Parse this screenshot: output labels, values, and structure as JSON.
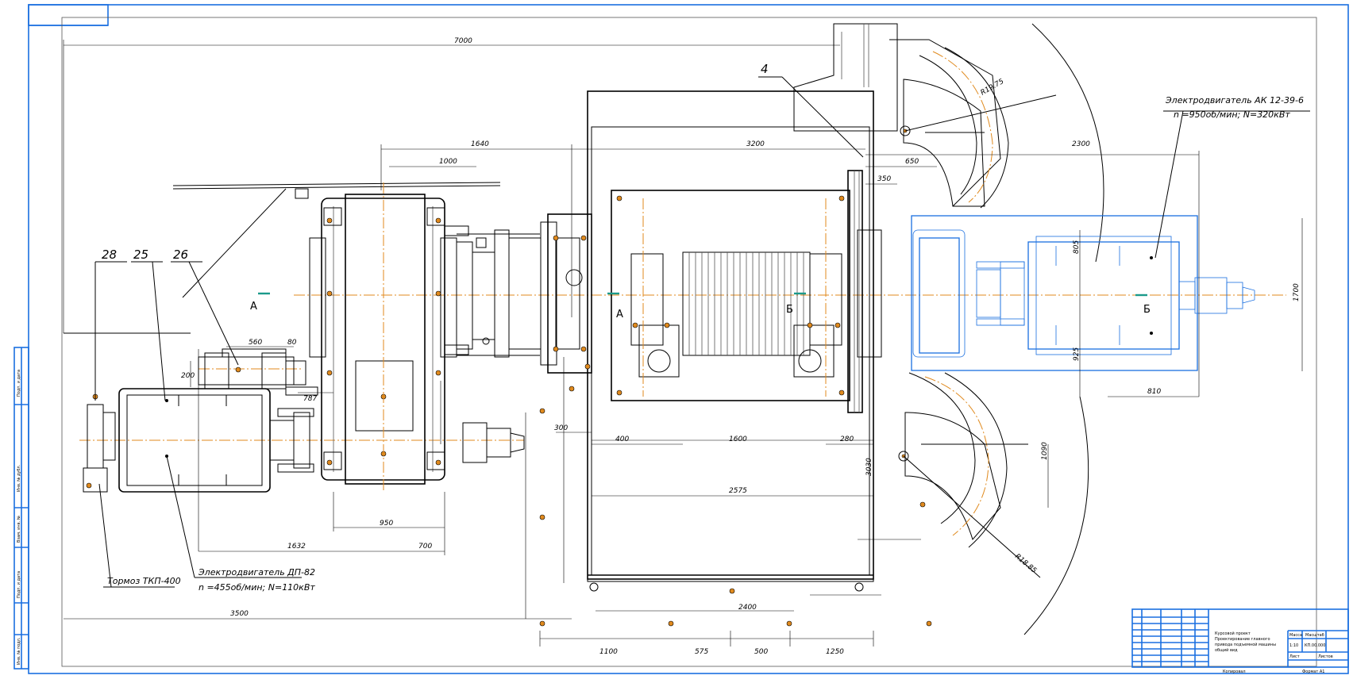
{
  "callouts": {
    "p4": "4",
    "p25": "25",
    "p26": "26",
    "p28": "28"
  },
  "notes": {
    "motor_big_name": "Электродвигатель АК 12-39-6",
    "motor_big_spec": "n =950об/мин; N=320кВт",
    "motor_small_name": "Электродвигатель ДП-82",
    "motor_small_spec": "n =455об/мин; N=110кВт",
    "brake": "Тормоз ТКП-400"
  },
  "sections": {
    "a1": "А",
    "a2": "А",
    "b1": "Б",
    "b2": "Б"
  },
  "dims": {
    "d7000": "7000",
    "d1640": "1640",
    "d1000": "1000",
    "d3200": "3200",
    "d2300": "2300",
    "d650": "650",
    "d350": "350",
    "d560": "560",
    "d80": "80",
    "d200": "200",
    "d787": "787",
    "d300": "300",
    "d400": "400",
    "d1600": "1600",
    "d280": "280",
    "d2575": "2575",
    "d950": "950",
    "d1632": "1632",
    "d700": "700",
    "d3500": "3500",
    "d1100": "1100",
    "d575": "575",
    "d500": "500",
    "d1250": "1250",
    "d2400": "2400",
    "d1700": "1700",
    "d805": "805",
    "d925": "925",
    "d810": "810",
    "d1090": "1090",
    "d3030": "3030",
    "r1": "R19.75",
    "r2": "R18.85"
  },
  "title_block": {
    "doc_title_1": "Курсовой проект",
    "doc_title_2": "Проектирование главного",
    "doc_title_3": "привода подъемной машины",
    "doc_title_4": "общий вид",
    "mass": "1:10",
    "code": "КП.00.000",
    "sheet": "Лист",
    "sheets": "Листов",
    "scale_label": "Масса",
    "scale_value": "Масштаб",
    "copied": "Копировал",
    "format": "Формат А1"
  },
  "side_labels": {
    "s1": "Подп. и дата",
    "s2": "Инв. № дубл.",
    "s3": "Взам. инв. №",
    "s4": "Подп. и дата",
    "s5": "Инв. № подл."
  },
  "colors": {
    "axis": "#e08a1e",
    "frame": "#1a6fe0",
    "motor_highlight": "#1a6fe0"
  }
}
